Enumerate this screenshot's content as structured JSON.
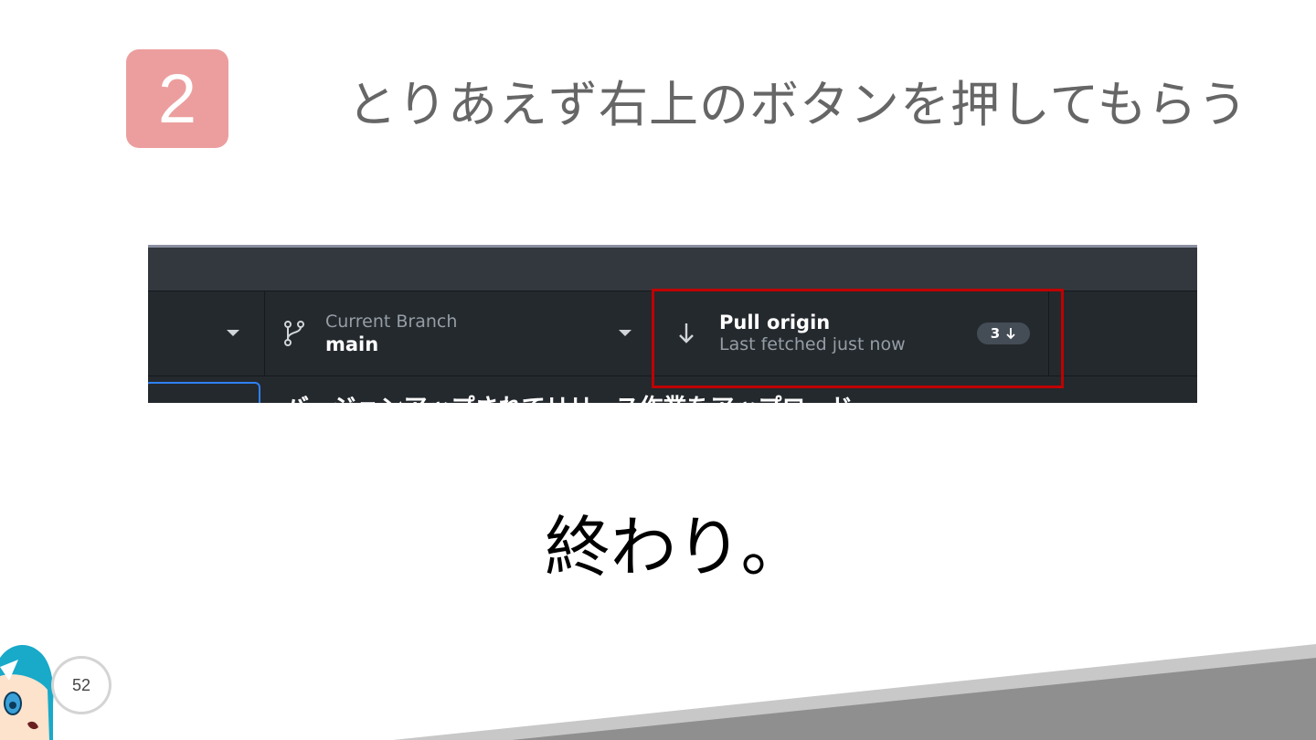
{
  "slide": {
    "step_number": "2",
    "title": "とりあえず右上のボタンを押してもらう",
    "closing_text": "終わり。",
    "page_number": "52"
  },
  "app_toolbar": {
    "current_branch": {
      "label": "Current Branch",
      "value": "main"
    },
    "pull": {
      "label": "Pull origin",
      "status": "Last fetched just now",
      "count": "3"
    },
    "commit_summary": "バージョンアップされてリリース作業をアップロード"
  },
  "colors": {
    "badge": "#ec9e9e",
    "title_text": "#666666",
    "app_background": "#24292e",
    "highlight_box": "#c00000"
  },
  "icons": [
    "branch-icon",
    "arrow-down-icon",
    "caret-down-icon",
    "mascot-character"
  ]
}
